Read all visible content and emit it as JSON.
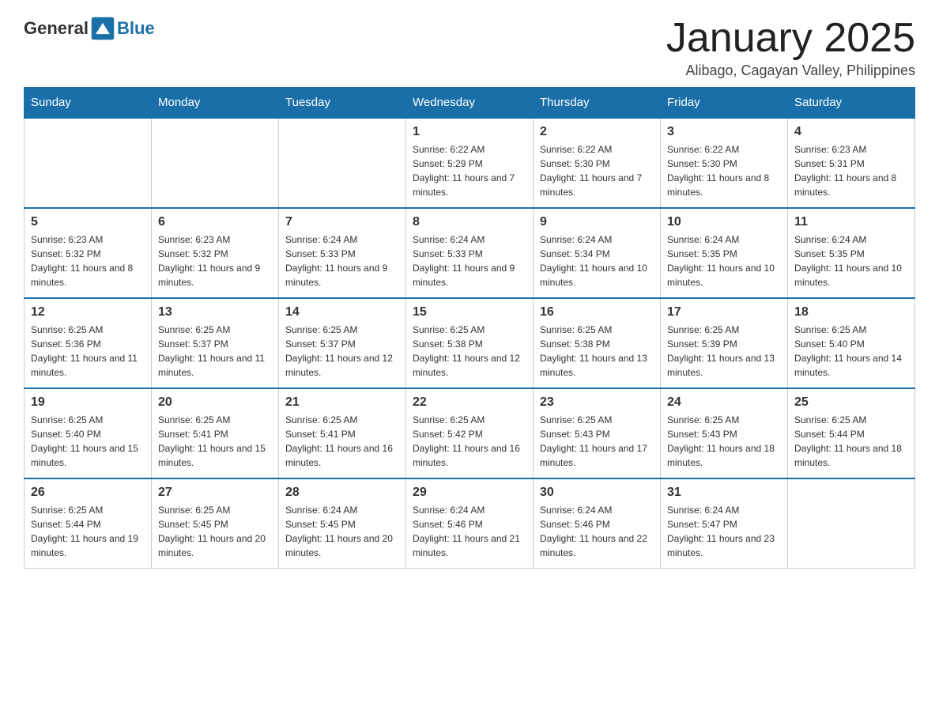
{
  "header": {
    "logo": {
      "general": "General",
      "blue": "Blue"
    },
    "month_title": "January 2025",
    "subtitle": "Alibago, Cagayan Valley, Philippines"
  },
  "days_of_week": [
    "Sunday",
    "Monday",
    "Tuesday",
    "Wednesday",
    "Thursday",
    "Friday",
    "Saturday"
  ],
  "weeks": [
    [
      {
        "day": "",
        "info": ""
      },
      {
        "day": "",
        "info": ""
      },
      {
        "day": "",
        "info": ""
      },
      {
        "day": "1",
        "info": "Sunrise: 6:22 AM\nSunset: 5:29 PM\nDaylight: 11 hours and 7 minutes."
      },
      {
        "day": "2",
        "info": "Sunrise: 6:22 AM\nSunset: 5:30 PM\nDaylight: 11 hours and 7 minutes."
      },
      {
        "day": "3",
        "info": "Sunrise: 6:22 AM\nSunset: 5:30 PM\nDaylight: 11 hours and 8 minutes."
      },
      {
        "day": "4",
        "info": "Sunrise: 6:23 AM\nSunset: 5:31 PM\nDaylight: 11 hours and 8 minutes."
      }
    ],
    [
      {
        "day": "5",
        "info": "Sunrise: 6:23 AM\nSunset: 5:32 PM\nDaylight: 11 hours and 8 minutes."
      },
      {
        "day": "6",
        "info": "Sunrise: 6:23 AM\nSunset: 5:32 PM\nDaylight: 11 hours and 9 minutes."
      },
      {
        "day": "7",
        "info": "Sunrise: 6:24 AM\nSunset: 5:33 PM\nDaylight: 11 hours and 9 minutes."
      },
      {
        "day": "8",
        "info": "Sunrise: 6:24 AM\nSunset: 5:33 PM\nDaylight: 11 hours and 9 minutes."
      },
      {
        "day": "9",
        "info": "Sunrise: 6:24 AM\nSunset: 5:34 PM\nDaylight: 11 hours and 10 minutes."
      },
      {
        "day": "10",
        "info": "Sunrise: 6:24 AM\nSunset: 5:35 PM\nDaylight: 11 hours and 10 minutes."
      },
      {
        "day": "11",
        "info": "Sunrise: 6:24 AM\nSunset: 5:35 PM\nDaylight: 11 hours and 10 minutes."
      }
    ],
    [
      {
        "day": "12",
        "info": "Sunrise: 6:25 AM\nSunset: 5:36 PM\nDaylight: 11 hours and 11 minutes."
      },
      {
        "day": "13",
        "info": "Sunrise: 6:25 AM\nSunset: 5:37 PM\nDaylight: 11 hours and 11 minutes."
      },
      {
        "day": "14",
        "info": "Sunrise: 6:25 AM\nSunset: 5:37 PM\nDaylight: 11 hours and 12 minutes."
      },
      {
        "day": "15",
        "info": "Sunrise: 6:25 AM\nSunset: 5:38 PM\nDaylight: 11 hours and 12 minutes."
      },
      {
        "day": "16",
        "info": "Sunrise: 6:25 AM\nSunset: 5:38 PM\nDaylight: 11 hours and 13 minutes."
      },
      {
        "day": "17",
        "info": "Sunrise: 6:25 AM\nSunset: 5:39 PM\nDaylight: 11 hours and 13 minutes."
      },
      {
        "day": "18",
        "info": "Sunrise: 6:25 AM\nSunset: 5:40 PM\nDaylight: 11 hours and 14 minutes."
      }
    ],
    [
      {
        "day": "19",
        "info": "Sunrise: 6:25 AM\nSunset: 5:40 PM\nDaylight: 11 hours and 15 minutes."
      },
      {
        "day": "20",
        "info": "Sunrise: 6:25 AM\nSunset: 5:41 PM\nDaylight: 11 hours and 15 minutes."
      },
      {
        "day": "21",
        "info": "Sunrise: 6:25 AM\nSunset: 5:41 PM\nDaylight: 11 hours and 16 minutes."
      },
      {
        "day": "22",
        "info": "Sunrise: 6:25 AM\nSunset: 5:42 PM\nDaylight: 11 hours and 16 minutes."
      },
      {
        "day": "23",
        "info": "Sunrise: 6:25 AM\nSunset: 5:43 PM\nDaylight: 11 hours and 17 minutes."
      },
      {
        "day": "24",
        "info": "Sunrise: 6:25 AM\nSunset: 5:43 PM\nDaylight: 11 hours and 18 minutes."
      },
      {
        "day": "25",
        "info": "Sunrise: 6:25 AM\nSunset: 5:44 PM\nDaylight: 11 hours and 18 minutes."
      }
    ],
    [
      {
        "day": "26",
        "info": "Sunrise: 6:25 AM\nSunset: 5:44 PM\nDaylight: 11 hours and 19 minutes."
      },
      {
        "day": "27",
        "info": "Sunrise: 6:25 AM\nSunset: 5:45 PM\nDaylight: 11 hours and 20 minutes."
      },
      {
        "day": "28",
        "info": "Sunrise: 6:24 AM\nSunset: 5:45 PM\nDaylight: 11 hours and 20 minutes."
      },
      {
        "day": "29",
        "info": "Sunrise: 6:24 AM\nSunset: 5:46 PM\nDaylight: 11 hours and 21 minutes."
      },
      {
        "day": "30",
        "info": "Sunrise: 6:24 AM\nSunset: 5:46 PM\nDaylight: 11 hours and 22 minutes."
      },
      {
        "day": "31",
        "info": "Sunrise: 6:24 AM\nSunset: 5:47 PM\nDaylight: 11 hours and 23 minutes."
      },
      {
        "day": "",
        "info": ""
      }
    ]
  ]
}
